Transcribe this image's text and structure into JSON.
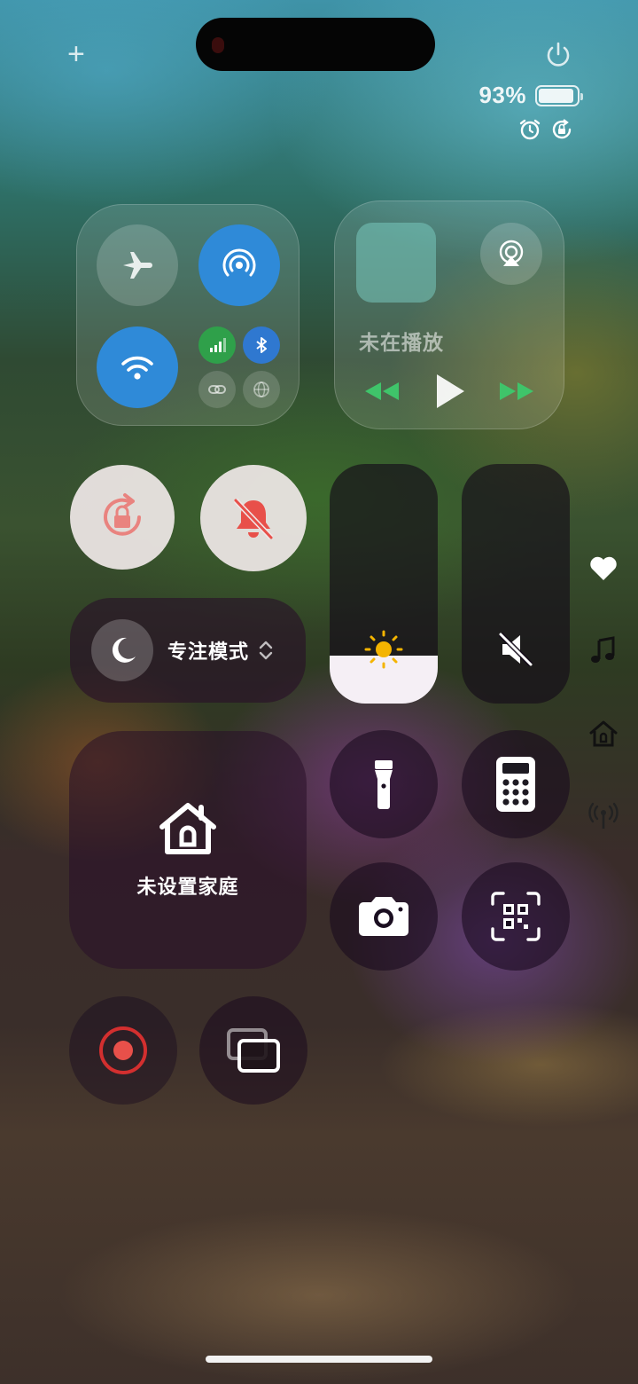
{
  "top": {
    "add_icon": "+"
  },
  "status": {
    "battery_percent": "93%",
    "battery_level": 0.93
  },
  "media": {
    "title": "未在播放"
  },
  "focus": {
    "label": "专注模式"
  },
  "home": {
    "label": "未设置家庭"
  },
  "sliders": {
    "brightness_level": 0.2,
    "volume_level": 0
  },
  "colors": {
    "accent_blue": "#2f8ad8",
    "cell_green": "#2fa04a",
    "red_alert": "#e8504a",
    "media_green": "#3fc46a"
  },
  "icons": [
    "plus-icon",
    "power-icon",
    "alarm-icon",
    "rotation-lock-icon",
    "airplane-icon",
    "airdrop-icon",
    "wifi-icon",
    "cellular-icon",
    "bluetooth-icon",
    "link-icon",
    "vpn-globe-icon",
    "airplay-icon",
    "rewind-icon",
    "play-icon",
    "forward-icon",
    "orientation-lock-icon",
    "silent-bell-icon",
    "moon-icon",
    "sun-icon",
    "mute-icon",
    "house-icon",
    "flashlight-icon",
    "calculator-icon",
    "camera-icon",
    "qr-scan-icon",
    "record-icon",
    "screen-mirror-icon",
    "heart-icon",
    "music-icon",
    "home-icon",
    "antenna-icon"
  ]
}
